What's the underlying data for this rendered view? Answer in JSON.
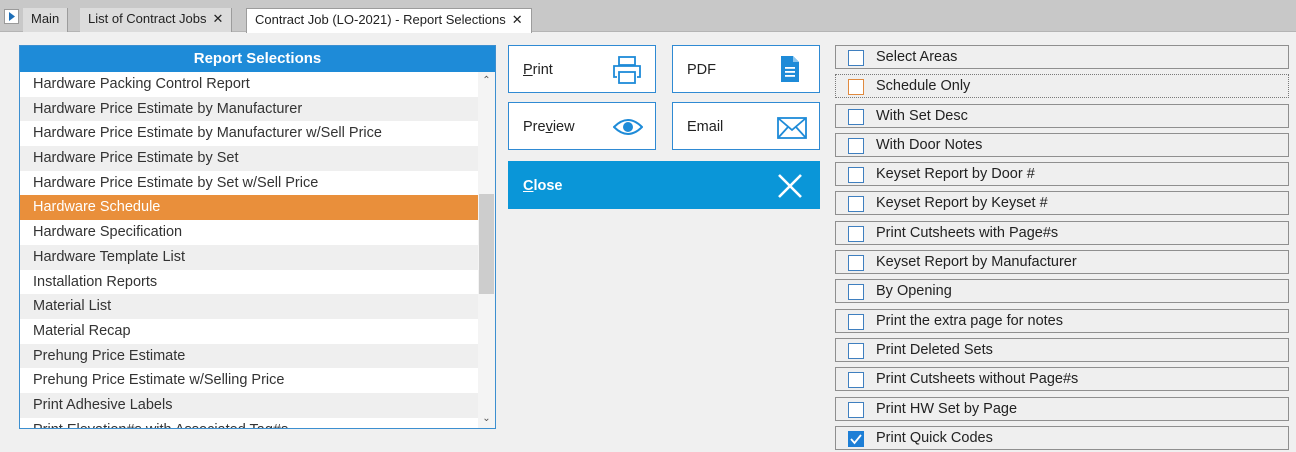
{
  "tabs": [
    {
      "label": "Main",
      "closable": false
    },
    {
      "label": "List of Contract Jobs",
      "closable": true
    },
    {
      "label": "Contract Job (LO-2021) - Report Selections",
      "closable": true,
      "active": true
    }
  ],
  "report_list": {
    "title": "Report Selections",
    "items": [
      "Hardware Packing Control Report",
      "Hardware Price Estimate by Manufacturer",
      "Hardware Price Estimate by Manufacturer w/Sell Price",
      "Hardware Price Estimate by Set",
      "Hardware Price Estimate by Set w/Sell Price",
      "Hardware Schedule",
      "Hardware Specification",
      "Hardware Template List",
      "Installation Reports",
      "Material List",
      "Material Recap",
      "Prehung Price Estimate",
      "Prehung Price Estimate w/Selling Price",
      "Print Adhesive Labels",
      "Print Elevation#s with Associated Tag#s"
    ],
    "selected": "Hardware Schedule"
  },
  "buttons": {
    "print": {
      "label": "Print",
      "icon": "printer-icon"
    },
    "pdf": {
      "label": "PDF",
      "icon": "document-icon"
    },
    "preview": {
      "label": "Preview",
      "icon": "eye-icon"
    },
    "email": {
      "label": "Email",
      "icon": "envelope-icon"
    },
    "close": {
      "label": "Close",
      "icon": "close-icon"
    }
  },
  "options": [
    {
      "label": "Select Areas",
      "checked": false
    },
    {
      "label": "Schedule Only",
      "checked": false,
      "focused": true
    },
    {
      "label": "With Set Desc",
      "checked": false
    },
    {
      "label": "With Door Notes",
      "checked": false
    },
    {
      "label": "Keyset Report by Door #",
      "checked": false
    },
    {
      "label": "Keyset Report by Keyset #",
      "checked": false
    },
    {
      "label": "Print Cutsheets with Page#s",
      "checked": false
    },
    {
      "label": "Keyset Report by Manufacturer",
      "checked": false
    },
    {
      "label": "By Opening",
      "checked": false
    },
    {
      "label": "Print the extra page for notes",
      "checked": false
    },
    {
      "label": "Print Deleted Sets",
      "checked": false
    },
    {
      "label": "Print Cutsheets without Page#s",
      "checked": false
    },
    {
      "label": "Print HW Set by Page",
      "checked": false
    },
    {
      "label": "Print Quick Codes",
      "checked": true
    }
  ],
  "colors": {
    "accent": "#1e8bd8",
    "selected_row": "#e98f3b",
    "close_button": "#0a96d8"
  }
}
